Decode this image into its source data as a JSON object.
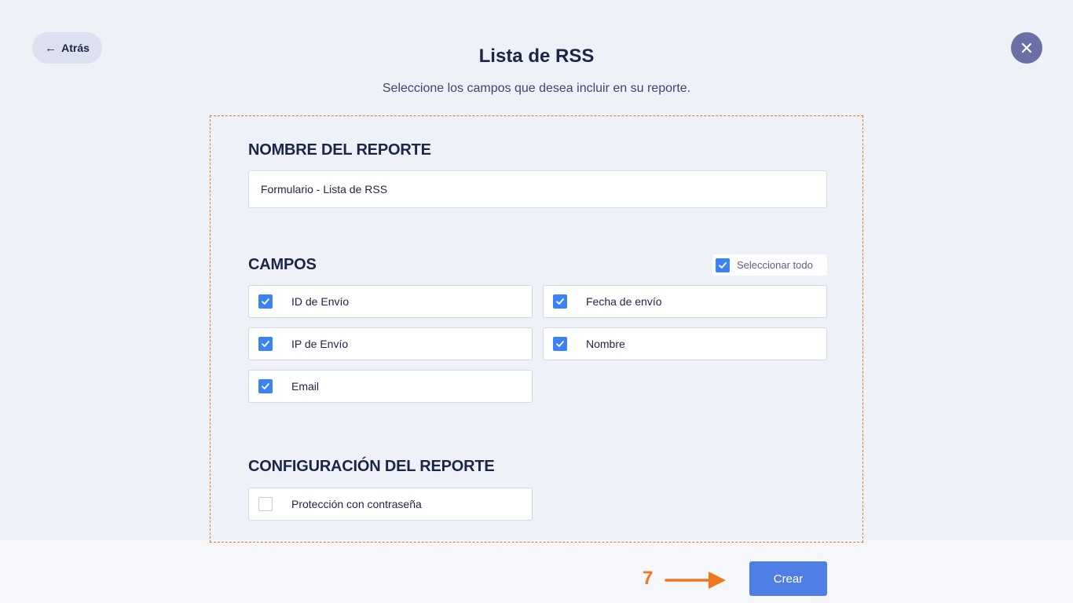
{
  "header": {
    "back_label": "Atrás",
    "title": "Lista de RSS",
    "subtitle": "Seleccione los campos que desea incluir en su reporte."
  },
  "report_name": {
    "heading": "NOMBRE DEL REPORTE",
    "value": "Formulario - Lista de RSS"
  },
  "fields": {
    "heading": "CAMPOS",
    "select_all_label": "Seleccionar todo",
    "select_all_checked": true,
    "items": [
      {
        "label": "ID de Envío",
        "checked": true
      },
      {
        "label": "Fecha de envío",
        "checked": true
      },
      {
        "label": "IP de Envío",
        "checked": true
      },
      {
        "label": "Nombre",
        "checked": true
      },
      {
        "label": "Email",
        "checked": true
      }
    ]
  },
  "config": {
    "heading": "CONFIGURACIÓN DEL REPORTE",
    "items": [
      {
        "label": "Protección con contraseña",
        "checked": false
      }
    ]
  },
  "footer": {
    "create_label": "Crear"
  },
  "annotation": {
    "step_number": "7",
    "color": "#f0771f"
  },
  "colors": {
    "checkbox": "#3b82f6",
    "primary_button": "#4f7fe4",
    "close_button": "#6a6fa6",
    "highlight": "#f0771f"
  }
}
